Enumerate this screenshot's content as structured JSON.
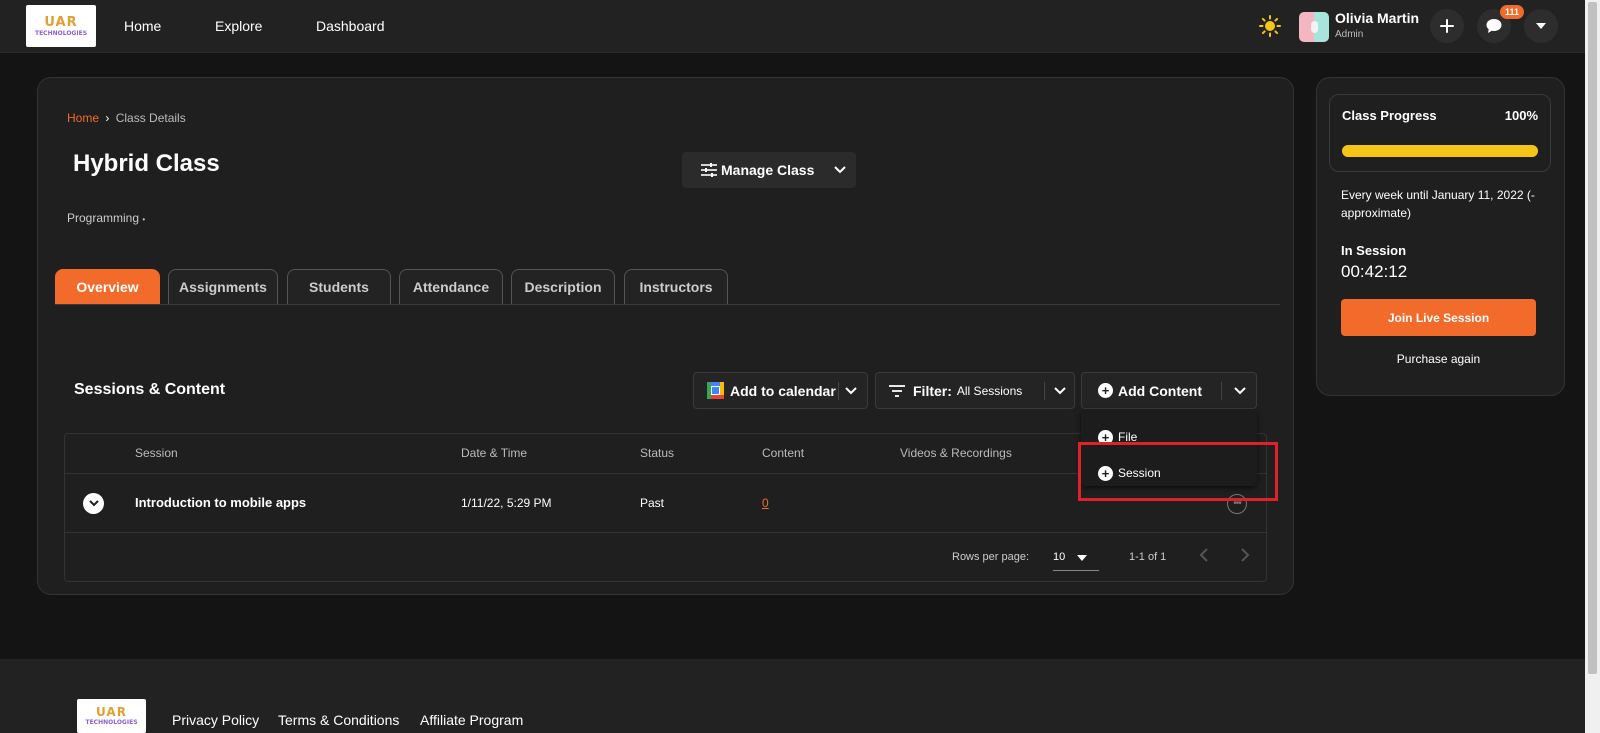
{
  "brand": {
    "logo_line1": "UAR",
    "logo_line2": "TECHNOLOGIES"
  },
  "nav": {
    "home": "Home",
    "explore": "Explore",
    "dashboard": "Dashboard"
  },
  "user": {
    "name": "Olivia Martin",
    "role": "Admin",
    "notification_count": "111"
  },
  "icons": {
    "theme": "sun-icon",
    "add": "plus-icon",
    "chat": "chat-bubble-icon",
    "menu": "chevron-down-icon"
  },
  "breadcrumb": {
    "home": "Home",
    "separator": "›",
    "current": "Class Details"
  },
  "class": {
    "title": "Hybrid Class",
    "subject": "Programming",
    "subject_dot": "•",
    "manage_label": "Manage Class"
  },
  "tabs": [
    "Overview",
    "Assignments",
    "Students",
    "Attendance",
    "Description",
    "Instructors"
  ],
  "sessions": {
    "heading": "Sessions & Content",
    "add_to_calendar": "Add to calendar",
    "filter_label": "Filter:",
    "filter_value": "All Sessions",
    "add_content": "Add Content",
    "menu": {
      "file": "File",
      "session": "Session"
    },
    "columns": {
      "session": "Session",
      "datetime": "Date & Time",
      "status": "Status",
      "content": "Content",
      "videos": "Videos & Recordings"
    },
    "rows": [
      {
        "session": "Introduction to mobile apps",
        "datetime": "1/11/22, 5:29 PM",
        "status": "Past",
        "content": "0"
      }
    ],
    "pagination": {
      "rows_label": "Rows per page:",
      "rows_value": "10",
      "range": "1-1 of 1"
    }
  },
  "progress": {
    "label": "Class Progress",
    "percent": "100%",
    "fraction": 1.0,
    "bar_color": "#f5c518"
  },
  "schedule": {
    "text": "Every week until January 11, 2022 (- approximate)"
  },
  "live": {
    "label": "In Session",
    "timer": "00:42:12",
    "join": "Join Live Session",
    "purchase": "Purchase again"
  },
  "footer": {
    "privacy": "Privacy Policy",
    "terms": "Terms & Conditions",
    "affiliate": "Affiliate Program"
  },
  "colors": {
    "accent": "#f26b2b",
    "highlight": "#e0202a"
  }
}
